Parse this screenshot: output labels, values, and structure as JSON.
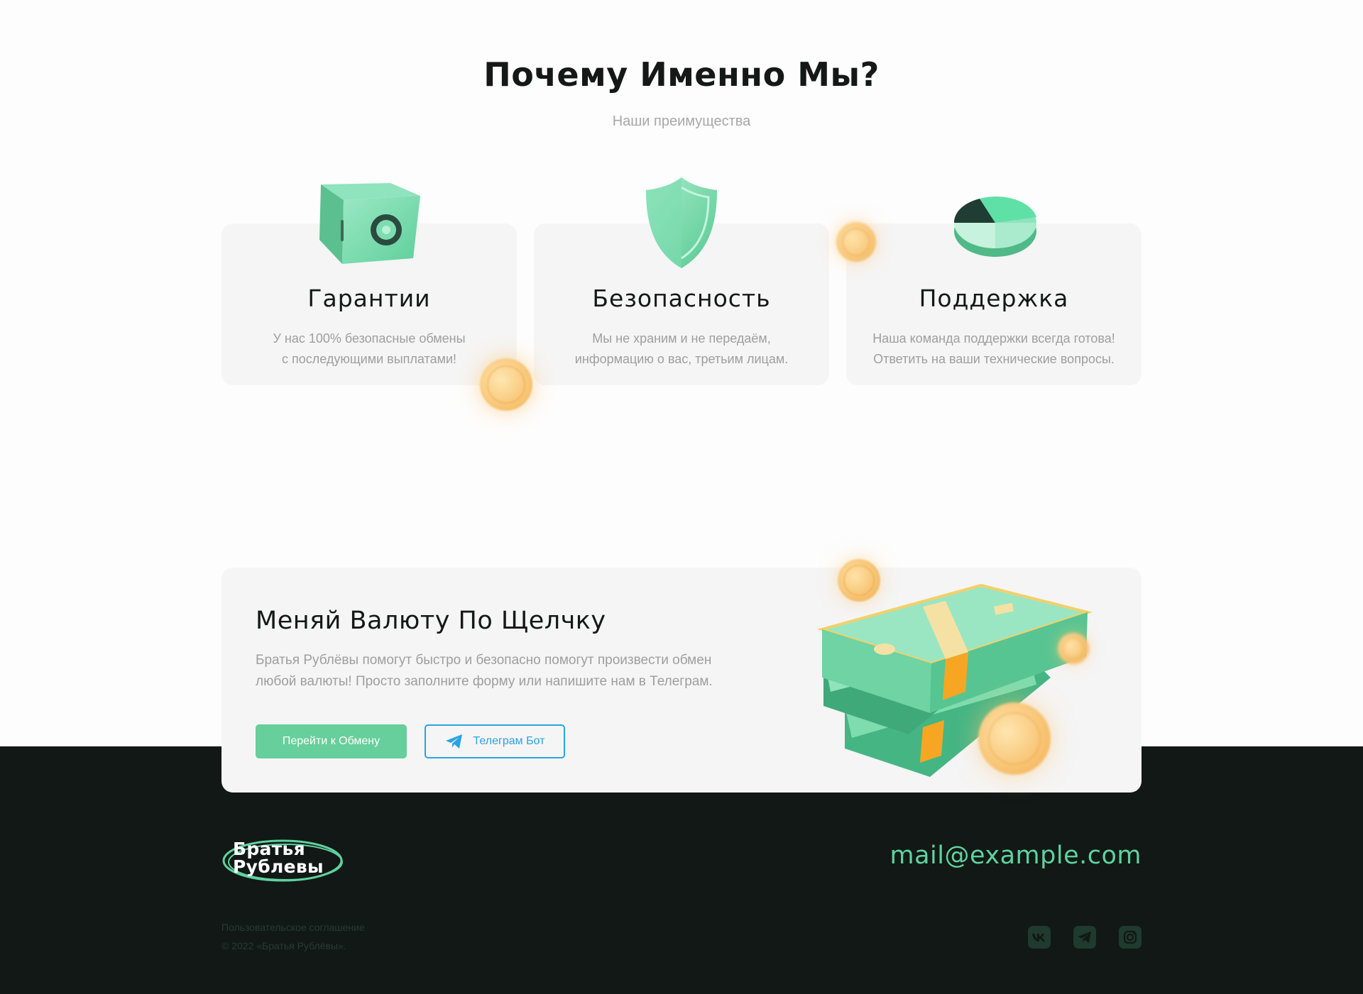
{
  "why": {
    "title": "Почему Именно Мы?",
    "subtitle": "Наши преимущества",
    "cards": [
      {
        "title": "Гарантии",
        "lines": [
          "У нас 100% безопасные обмены",
          "с последующими выплатами!"
        ],
        "icon": "safe-icon"
      },
      {
        "title": "Безопасность",
        "lines": [
          "Мы не храним и не передаём,",
          "информацию о вас, третьим лицам."
        ],
        "icon": "shield-icon"
      },
      {
        "title": "Поддержка",
        "lines": [
          "Наша команда поддержки всегда готова!",
          "Ответить на ваши технические вопросы."
        ],
        "icon": "pie-chart-icon"
      }
    ]
  },
  "banner": {
    "title": "Меняй Валюту По Щелчку",
    "lines": [
      "Братья Рублёвы помогут быстро и безопасно помогут произвести обмен",
      "любой валюты! Просто заполните форму или напишите нам в Телеграм."
    ],
    "primary_button": "Перейти к Обмену",
    "telegram_button": "Телеграм Бот"
  },
  "footer": {
    "logo_lines": [
      "Братья",
      "Рублевы"
    ],
    "email": "mail@example.com",
    "agreement": "Пользовательское соглашение",
    "copyright": "© 2022 «Братья Рублёвы».",
    "socials": [
      "vk-icon",
      "telegram-icon",
      "instagram-icon"
    ]
  },
  "colors": {
    "accent": "#66cf9b",
    "telegram": "#2aa3e3",
    "footer_bg": "#111816",
    "card_bg": "#f5f5f5"
  }
}
